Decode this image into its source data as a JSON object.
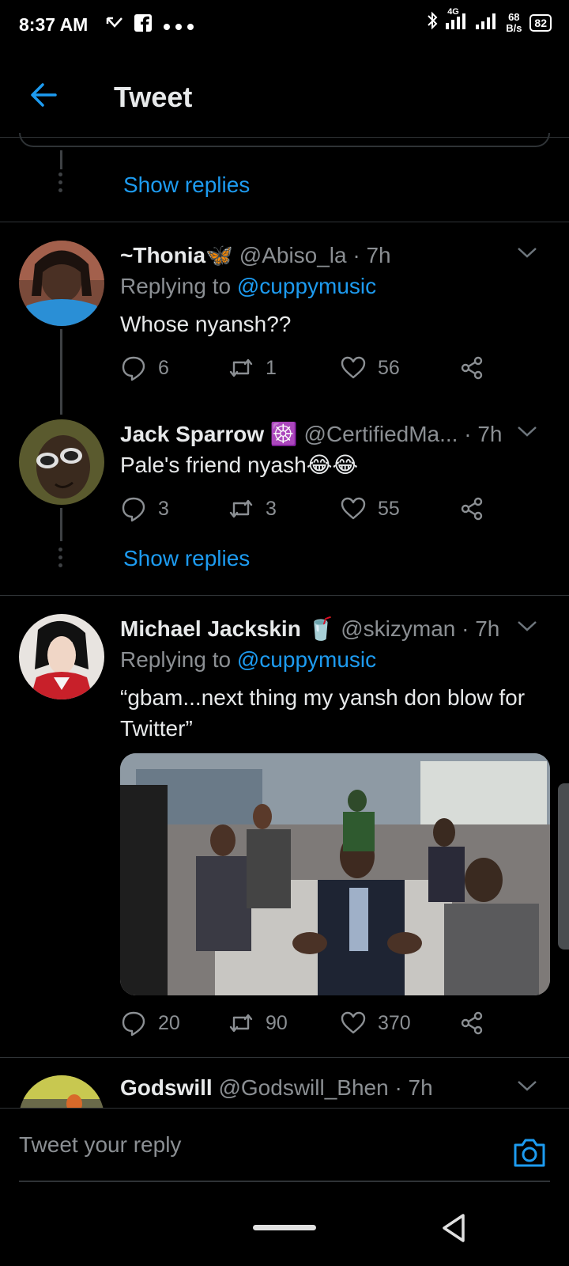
{
  "status_bar": {
    "time": "8:37 AM",
    "network": "4G",
    "speed_value": "68",
    "speed_unit": "B/s",
    "battery": "82"
  },
  "header": {
    "title": "Tweet"
  },
  "show_replies_label": "Show replies",
  "tweets": [
    {
      "name": "~Thonia🦋",
      "handle": "@Abiso_la · 7h",
      "replying_prefix": "Replying to ",
      "replying_to": "@cuppymusic",
      "text": "Whose nyansh??",
      "replies": "6",
      "retweets": "1",
      "likes": "56"
    },
    {
      "name": "Jack Sparrow ☸️",
      "handle": "@CertifiedMa... · 7h",
      "text": "Pale's friend nyash😂😂",
      "replies": "3",
      "retweets": "3",
      "likes": "55"
    },
    {
      "name": "Michael Jackskin 🥤",
      "handle": "@skizyman · 7h",
      "replying_prefix": "Replying to ",
      "replying_to": "@cuppymusic",
      "text": "“gbam...next thing my yansh don blow for Twitter”",
      "replies": "20",
      "retweets": "90",
      "likes": "370"
    },
    {
      "name": "Godswill",
      "handle": "@Godswill_Bhen · 7h"
    }
  ],
  "reply_bar": {
    "placeholder": "Tweet your reply"
  },
  "colors": {
    "accent": "#1d9bf0",
    "background": "#000000",
    "muted": "#8b8f93"
  }
}
